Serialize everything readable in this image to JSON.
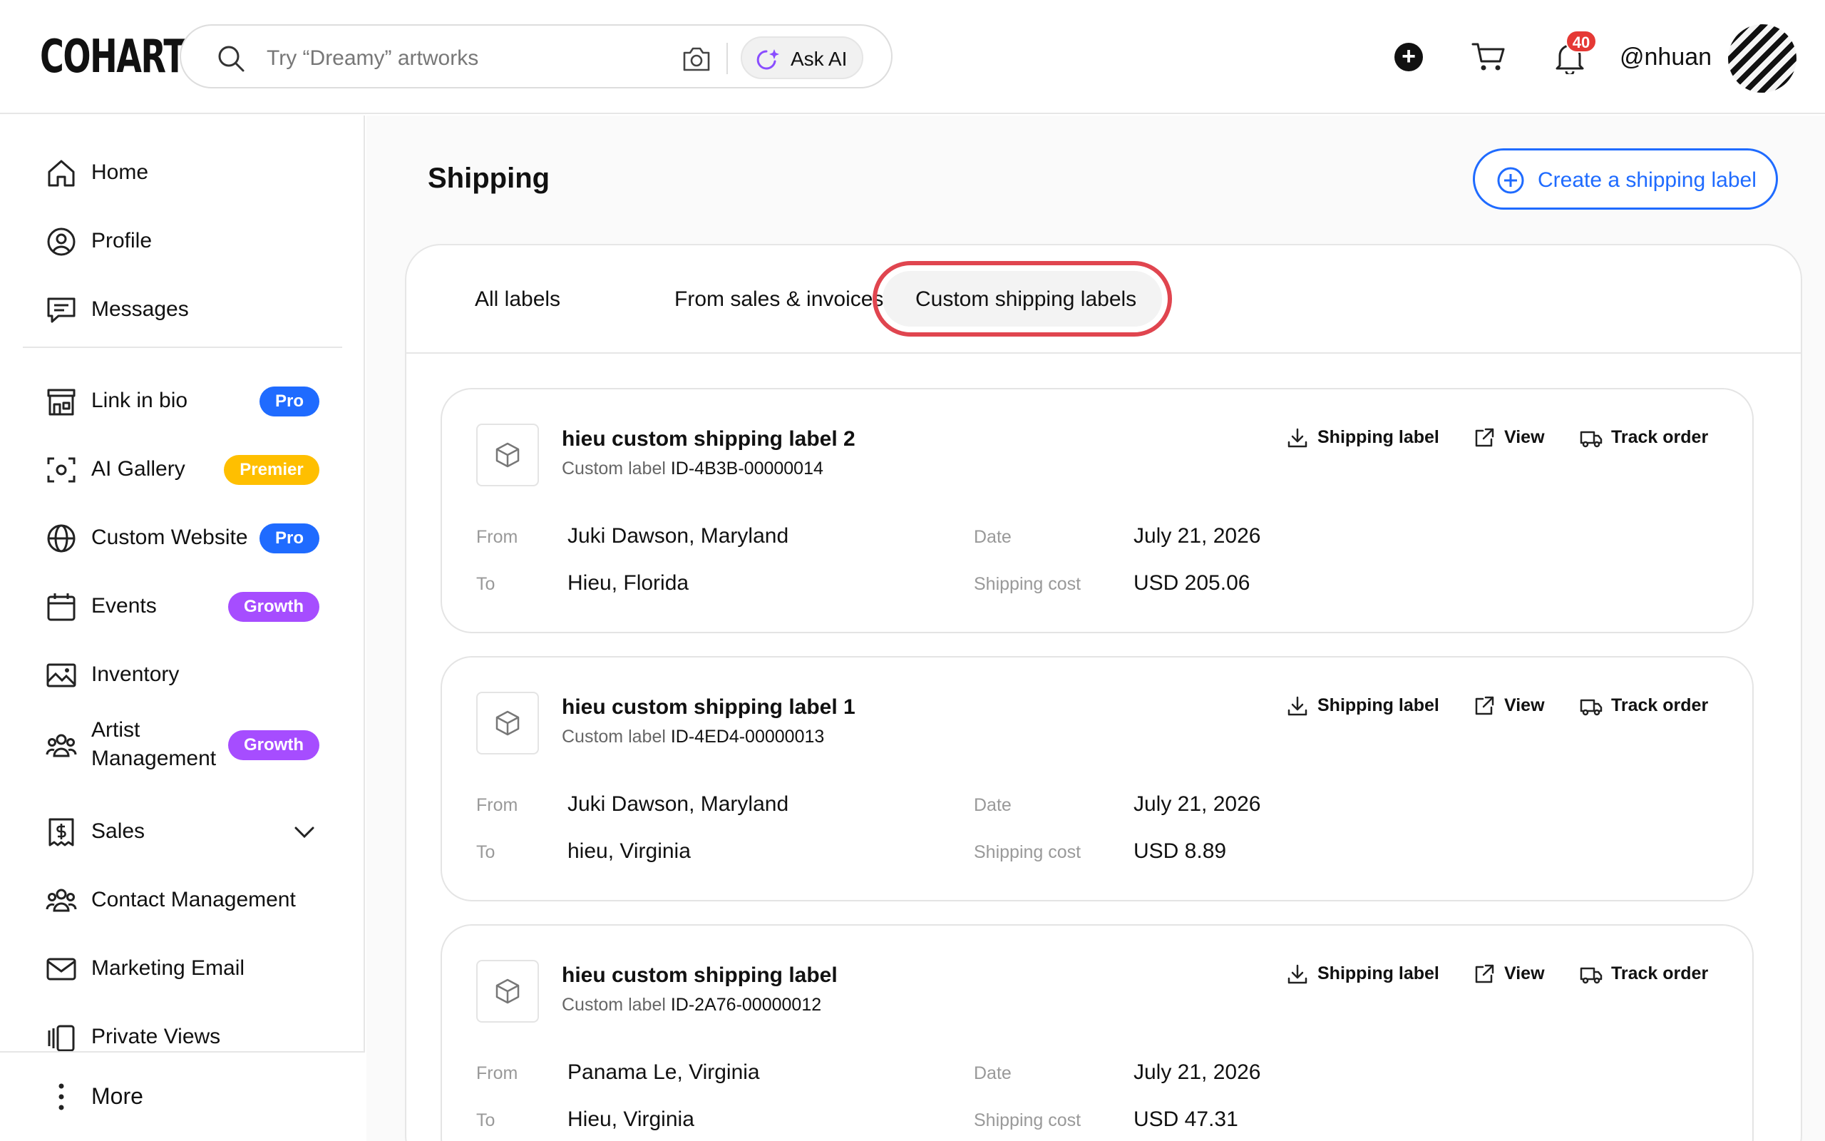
{
  "header": {
    "logo": "COHART",
    "search_placeholder": "Try “Dreamy” artworks",
    "ask_ai_label": "Ask AI",
    "notification_count": "40",
    "username": "@nhuan"
  },
  "sidebar": {
    "items": [
      {
        "label": "Home",
        "icon": "home-icon"
      },
      {
        "label": "Profile",
        "icon": "user-icon"
      },
      {
        "label": "Messages",
        "icon": "message-icon"
      },
      {
        "label": "Link in bio",
        "icon": "storefront-icon",
        "badge": "Pro"
      },
      {
        "label": "AI Gallery",
        "icon": "scan-icon",
        "badge": "Premier"
      },
      {
        "label": "Custom Website",
        "icon": "globe-icon",
        "badge": "Pro"
      },
      {
        "label": "Events",
        "icon": "calendar-icon",
        "badge": "Growth"
      },
      {
        "label": "Inventory",
        "icon": "image-icon"
      },
      {
        "label_line1": "Artist",
        "label_line2": "Management",
        "icon": "people-icon",
        "badge": "Growth"
      },
      {
        "label": "Sales",
        "icon": "dollar-icon"
      },
      {
        "label": "Contact Management",
        "icon": "contacts-icon"
      },
      {
        "label": "Marketing Email",
        "icon": "mail-icon"
      },
      {
        "label": "Private Views",
        "icon": "views-icon"
      }
    ],
    "more_label": "More"
  },
  "main": {
    "title": "Shipping",
    "create_button": "Create a shipping label",
    "tabs": [
      "All labels",
      "From sales & invoices",
      "Custom shipping labels"
    ],
    "active_tab": "Custom shipping labels",
    "field_labels": {
      "from": "From",
      "to": "To",
      "date": "Date",
      "cost": "Shipping cost"
    },
    "actions": {
      "shipping_label": "Shipping label",
      "view": "View",
      "track": "Track order"
    },
    "sub_prefix": "Custom label",
    "cards": [
      {
        "title": "hieu custom shipping label 2",
        "id": "ID-4B3B-00000014",
        "from": "Juki Dawson, Maryland",
        "to": "Hieu, Florida",
        "date": "July 21, 2026",
        "cost": "USD 205.06"
      },
      {
        "title": "hieu custom shipping label 1",
        "id": "ID-4ED4-00000013",
        "from": "Juki Dawson, Maryland",
        "to": "hieu, Virginia",
        "date": "July 21, 2026",
        "cost": "USD 8.89"
      },
      {
        "title": "hieu custom shipping label",
        "id": "ID-2A76-00000012",
        "from": "Panama Le, Virginia",
        "to": "Hieu, Virginia",
        "date": "July 21, 2026",
        "cost": "USD 47.31"
      }
    ]
  }
}
